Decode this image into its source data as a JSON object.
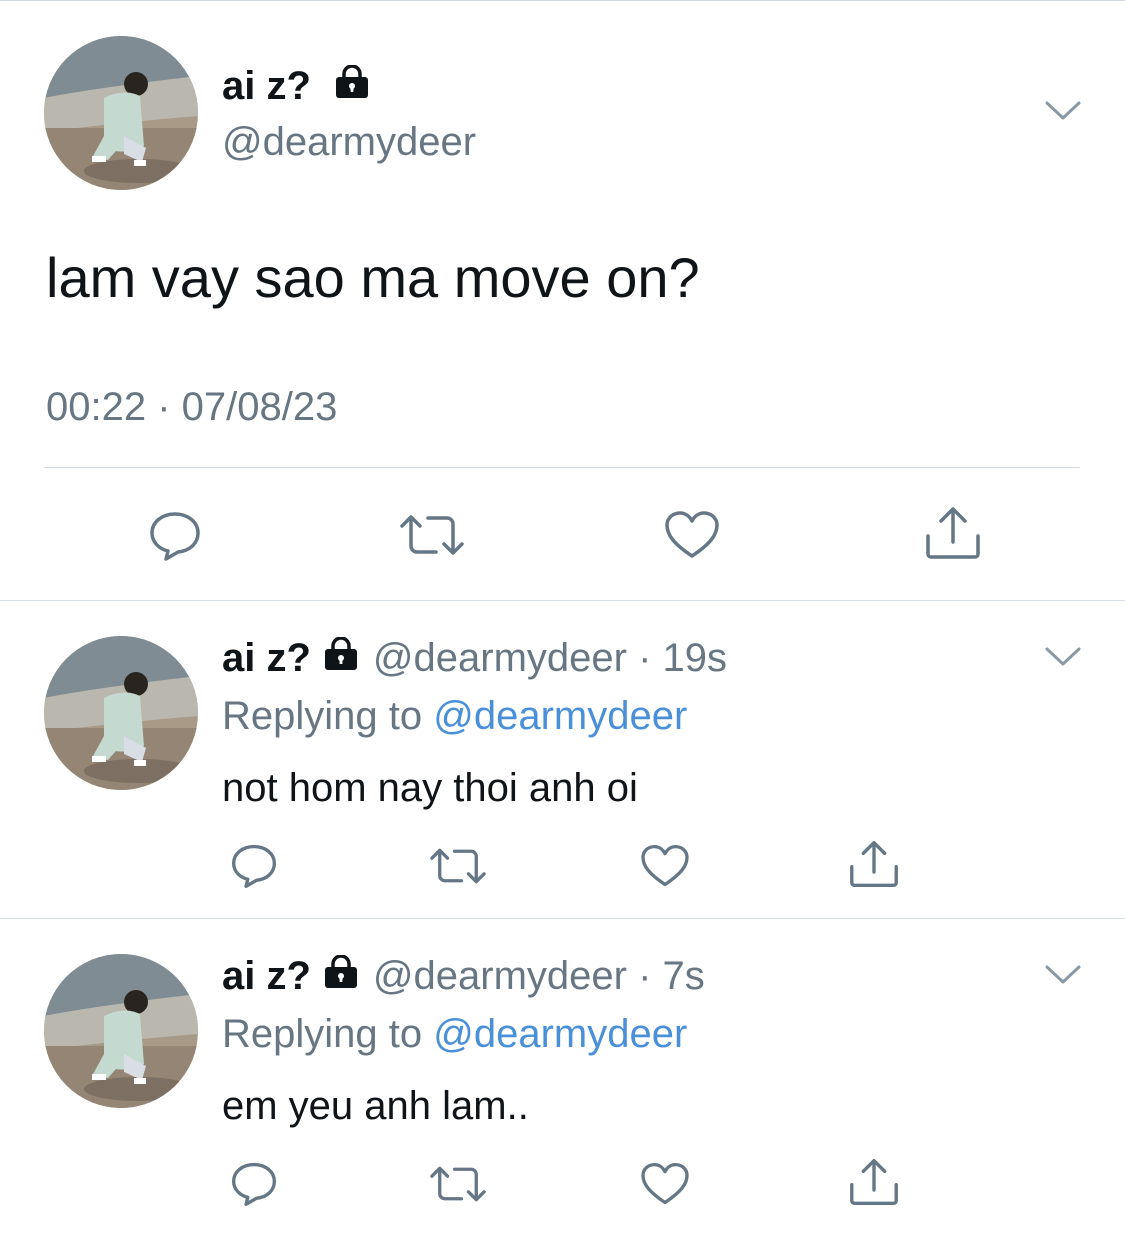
{
  "main_tweet": {
    "display_name": "ai z?",
    "handle": "@dearmydeer",
    "text": "lam vay sao ma move on?",
    "timestamp": "00:22 · 07/08/23",
    "locked": true
  },
  "replies": [
    {
      "display_name": "ai z?",
      "handle": "@dearmydeer",
      "time_ago": "· 19s",
      "replying_prefix": "Replying to",
      "replying_handle": "@dearmydeer",
      "text": "not hom nay thoi anh oi",
      "locked": true
    },
    {
      "display_name": "ai z?",
      "handle": "@dearmydeer",
      "time_ago": "· 7s",
      "replying_prefix": "Replying to",
      "replying_handle": "@dearmydeer",
      "text": "em yeu anh lam..",
      "locked": true
    }
  ],
  "actions": {
    "reply_icon": "speech-bubble-icon",
    "retweet_icon": "retweet-arrows-icon",
    "like_icon": "heart-icon",
    "share_icon": "share-upload-icon"
  },
  "colors": {
    "text": "#0f1419",
    "secondary": "#687684",
    "link": "#4a90d9",
    "divider": "#d5dde2"
  }
}
